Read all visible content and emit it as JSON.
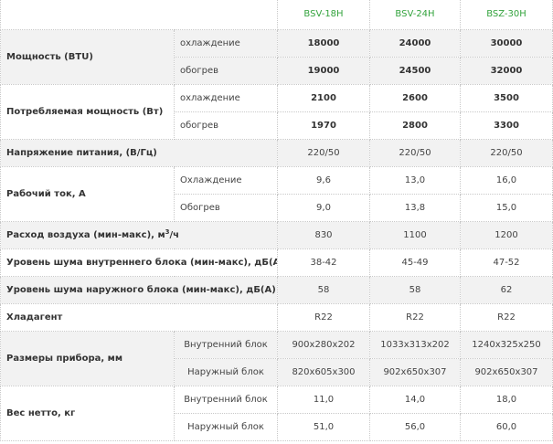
{
  "models": [
    "BSV-18H",
    "BSV-24H",
    "BSZ-30H"
  ],
  "rows": {
    "power_btu": {
      "label": "Мощность (BTU)",
      "cooling": {
        "label": "охлаждение",
        "values": [
          "18000",
          "24000",
          "30000"
        ]
      },
      "heating": {
        "label": "обогрев",
        "values": [
          "19000",
          "24500",
          "32000"
        ]
      }
    },
    "power_consumption": {
      "label": "Потребляемая мощность (Вт)",
      "cooling": {
        "label": "охлаждение",
        "values": [
          "2100",
          "2600",
          "3500"
        ]
      },
      "heating": {
        "label": "обогрев",
        "values": [
          "1970",
          "2800",
          "3300"
        ]
      }
    },
    "voltage": {
      "label": "Напряжение питания, (В/Гц)",
      "values": [
        "220/50",
        "220/50",
        "220/50"
      ]
    },
    "current": {
      "label": "Рабочий ток, А",
      "cooling": {
        "label": "Охлаждение",
        "values": [
          "9,6",
          "13,0",
          "16,0"
        ]
      },
      "heating": {
        "label": "Обогрев",
        "values": [
          "9,0",
          "13,8",
          "15,0"
        ]
      }
    },
    "airflow": {
      "label": "Расход воздуха (мин-макс), м",
      "unit_sup": "3",
      "label_suffix": "/ч",
      "values": [
        "830",
        "1100",
        "1200"
      ]
    },
    "noise_indoor": {
      "label": "Уровень шума внутреннего блока (мин-макс), дБ(А)",
      "values": [
        "38-42",
        "45-49",
        "47-52"
      ]
    },
    "noise_outdoor": {
      "label": "Уровень шума наружного блока (мин-макс), дБ(А)",
      "values": [
        "58",
        "58",
        "62"
      ]
    },
    "refrigerant": {
      "label": "Хладагент",
      "values": [
        "R22",
        "R22",
        "R22"
      ]
    },
    "dimensions": {
      "label": "Размеры прибора, мм",
      "indoor": {
        "label": "Внутренний блок",
        "values": [
          "900x280x202",
          "1033x313x202",
          "1240x325x250"
        ]
      },
      "outdoor": {
        "label": "Наружный блок",
        "values": [
          "820x605x300",
          "902x650x307",
          "902x650x307"
        ]
      }
    },
    "weight": {
      "label": "Вес нетто, кг",
      "indoor": {
        "label": "Внутренний блок",
        "values": [
          "11,0",
          "14,0",
          "18,0"
        ]
      },
      "outdoor": {
        "label": "Наружный блок",
        "values": [
          "51,0",
          "56,0",
          "60,0"
        ]
      }
    }
  },
  "colors": {
    "model_header": "#33a33d",
    "row_shade": "#f2f2f2",
    "border": "#c8c8c8",
    "text": "#333333"
  }
}
